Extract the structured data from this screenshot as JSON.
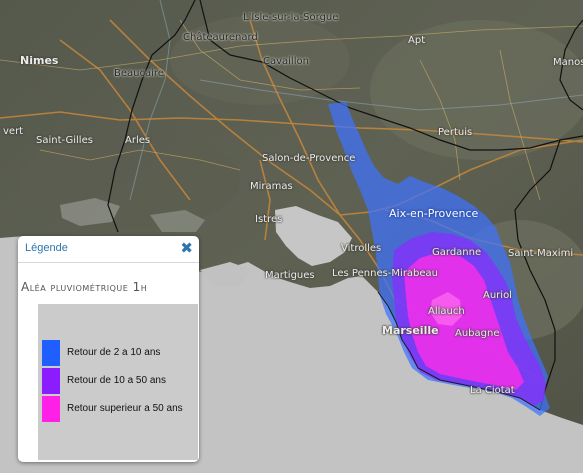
{
  "map": {
    "places": {
      "lisle": "L'Isle-sur-la-Sorgue",
      "chateaurenard": "Châteaurenard",
      "apt": "Apt",
      "nimes": "Nimes",
      "beaucaire": "Beaucaire",
      "cavaillon": "Cavaillon",
      "manosque": "Manosq",
      "vert": "vert",
      "saint_gilles": "Saint-Gilles",
      "arles": "Arles",
      "pertuis": "Pertuis",
      "salon": "Salon-de-Provence",
      "miramas": "Miramas",
      "aix": "Aix-en-Provence",
      "istres": "Istres",
      "vitrolles": "Vitrolles",
      "gardanne": "Gardanne",
      "saint_maximin": "Saint-Maximi",
      "martigues": "Martigues",
      "les_pennes": "Les Pennes-Mirabeau",
      "auriol": "Auriol",
      "allauch": "Allauch",
      "marseille": "Marseille",
      "aubagne": "Aubagne",
      "la_ciotat": "La Ciotat"
    }
  },
  "legend": {
    "title": "Légende",
    "close_icon": "close-icon",
    "layer_title": "Aléa pluviométrique 1h",
    "items": [
      {
        "label": "Retour de 2 a 10 ans",
        "color": "#1f5fff"
      },
      {
        "label": "Retour de 10 a 50 ans",
        "color": "#8b1cff"
      },
      {
        "label": "Retour superieur a 50 ans",
        "color": "#ff1fe6"
      }
    ]
  }
}
